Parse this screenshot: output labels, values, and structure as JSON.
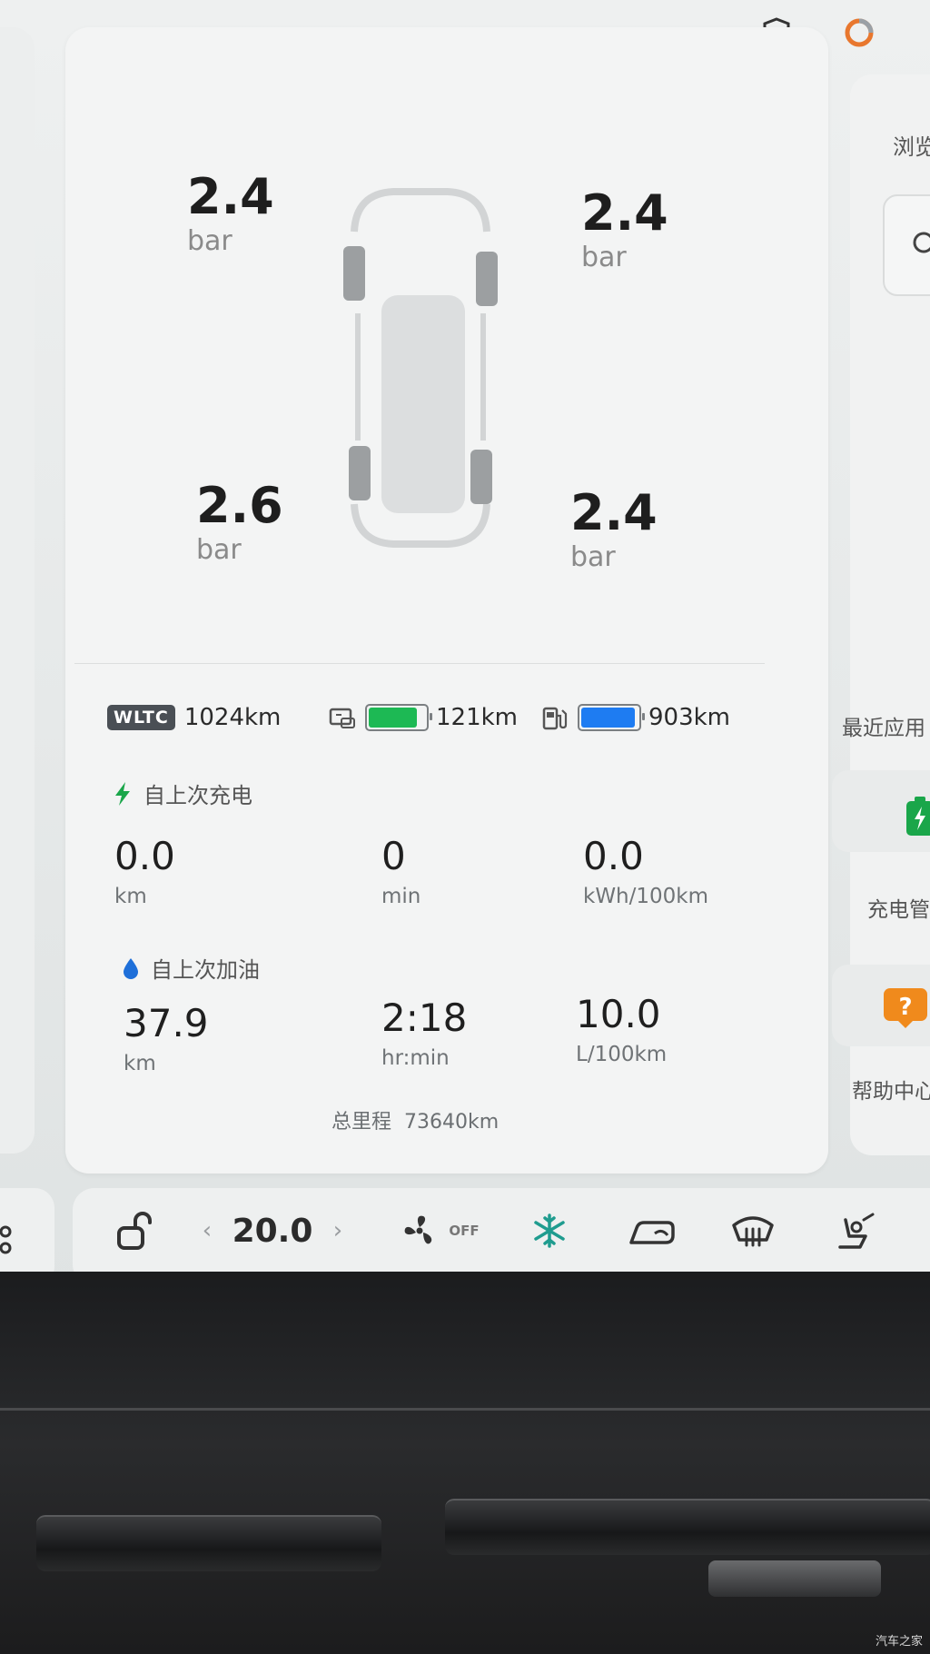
{
  "tires": {
    "front_left": {
      "value": "2.4",
      "unit": "bar"
    },
    "front_right": {
      "value": "2.4",
      "unit": "bar"
    },
    "rear_left": {
      "value": "2.6",
      "unit": "bar"
    },
    "rear_right": {
      "value": "2.4",
      "unit": "bar"
    }
  },
  "range": {
    "wltc_badge": "WLTC",
    "wltc_value": "1024km",
    "electric_value": "121km",
    "electric_level": 0.85,
    "fuel_value": "903km",
    "fuel_level": 0.95,
    "colors": {
      "electric": "#1db954",
      "fuel": "#1e7cf2"
    }
  },
  "since_charge": {
    "title": "自上次充电",
    "stats": [
      {
        "value": "0.0",
        "unit": "km"
      },
      {
        "value": "0",
        "unit": "min"
      },
      {
        "value": "0.0",
        "unit": "kWh/100km"
      }
    ]
  },
  "since_refuel": {
    "title": "自上次加油",
    "stats": [
      {
        "value": "37.9",
        "unit": "km"
      },
      {
        "value": "2:18",
        "unit": "hr:min"
      },
      {
        "value": "10.0",
        "unit": "L/100km"
      }
    ]
  },
  "odometer": {
    "label": "总里程",
    "value": "73640km"
  },
  "side_panel": {
    "browse_label": "浏览",
    "recent_apps_label": "最近应用",
    "charge_app_label": "充电管",
    "help_app_label": "帮助中心"
  },
  "dock": {
    "temperature": "20.0",
    "fan_label": "OFF"
  },
  "watermark": "汽车之家"
}
